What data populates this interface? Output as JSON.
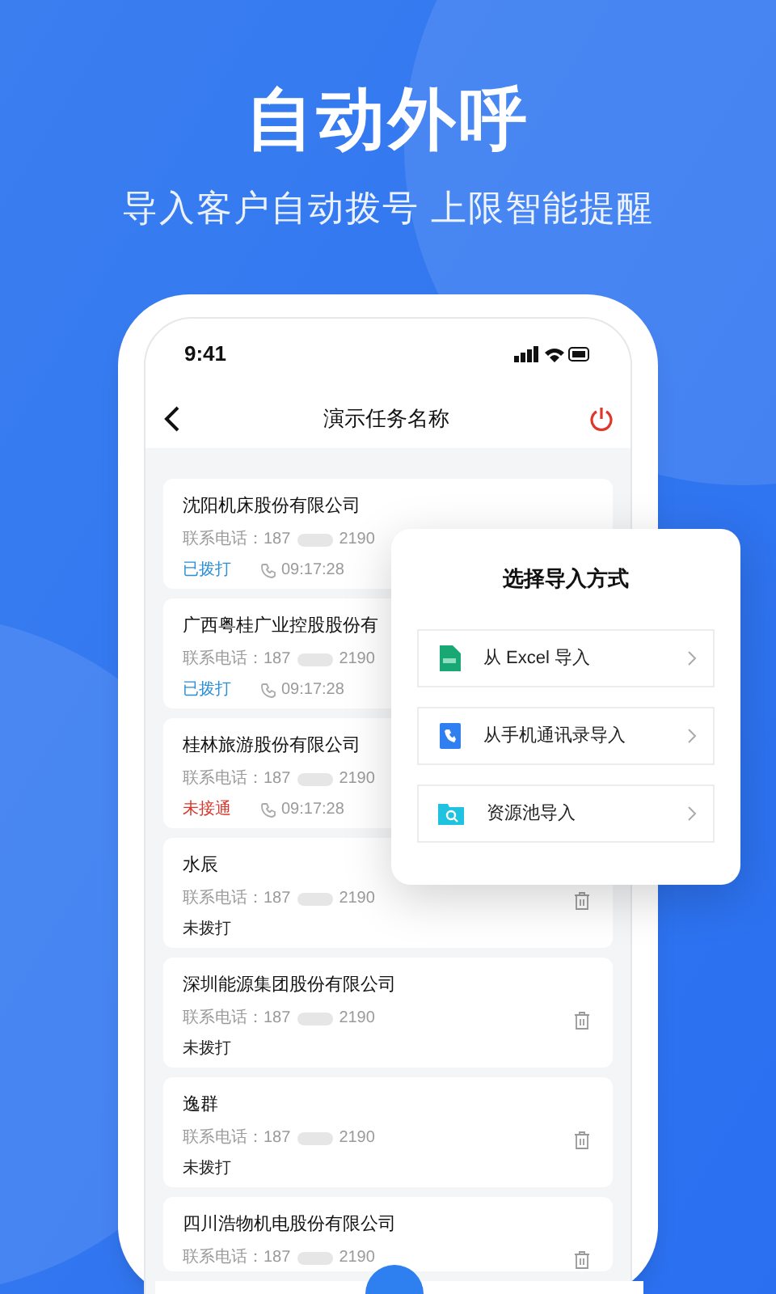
{
  "headline": "自动外呼",
  "subtitle": "导入客户自动拨号 上限智能提醒",
  "status_bar": {
    "time": "9:41"
  },
  "nav": {
    "title": "演示任务名称"
  },
  "contacts": [
    {
      "name": "沈阳机床股份有限公司",
      "phone_label": "联系电话：",
      "phone_start": "187",
      "phone_end": "2190",
      "status": "已拨打",
      "color": "#2b8fd6",
      "time": "09:17:28"
    },
    {
      "name": "广西粤桂广业控股股份有",
      "phone_label": "联系电话：",
      "phone_start": "187",
      "phone_end": "2190",
      "status": "已拨打",
      "color": "#2b8fd6",
      "time": "09:17:28"
    },
    {
      "name": "桂林旅游股份有限公司",
      "phone_label": "联系电话：",
      "phone_start": "187",
      "phone_end": "2190",
      "status": "未接通",
      "color": "#d9352c",
      "time": "09:17:28"
    },
    {
      "name": "水辰",
      "phone_label": "联系电话：",
      "phone_start": "187",
      "phone_end": "2190",
      "status": "未拨打",
      "color": "#222222"
    },
    {
      "name": "深圳能源集团股份有限公司",
      "phone_label": "联系电话：",
      "phone_start": "187",
      "phone_end": "2190",
      "status": "未拨打",
      "color": "#222222"
    },
    {
      "name": "逸群",
      "phone_label": "联系电话：",
      "phone_start": "187",
      "phone_end": "2190",
      "status": "未拨打",
      "color": "#222222"
    },
    {
      "name": "四川浩物机电股份有限公司",
      "phone_label": "联系电话：",
      "phone_start": "187",
      "phone_end": "2190"
    }
  ],
  "import_dialog": {
    "title": "选择导入方式",
    "options": [
      {
        "kind": "excel",
        "label": "从 Excel 导入"
      },
      {
        "kind": "contacts",
        "label": "从手机通讯录导入"
      },
      {
        "kind": "pool",
        "label": "资源池导入"
      }
    ]
  }
}
